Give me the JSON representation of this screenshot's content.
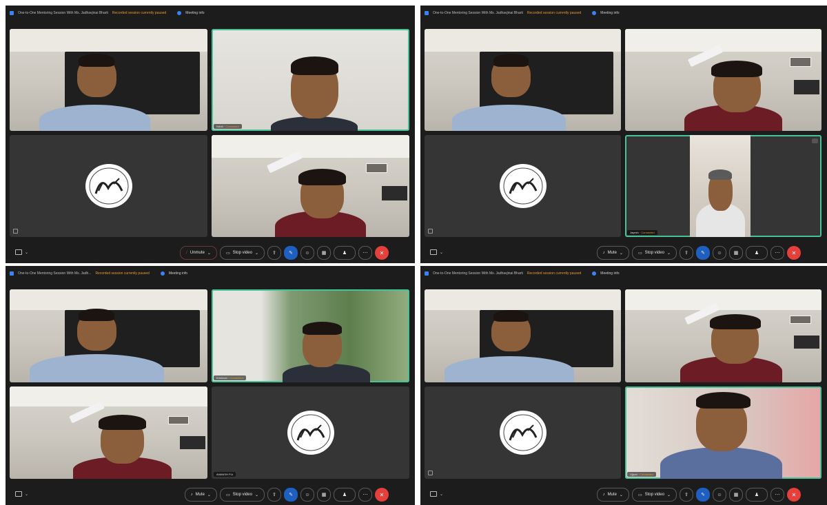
{
  "window": {
    "title": "One-to-One Mentoring Session With Ms. Jadhavjinai Bharti",
    "title_short": "One-to-One Mentoring Session With Ms. Jadh...",
    "recording_status": "Recorded session currently paused",
    "meeting_info": "Meeting info"
  },
  "toolbar": {
    "layout_label": "Layout",
    "unmute_label": "Unmute",
    "mute_label": "Mute",
    "stop_video_label": "Stop video",
    "mic_icon": "microphone-icon",
    "camera_icon": "camera-icon",
    "leave_icon": "phone-hangup-icon"
  },
  "participants": {
    "quad0_tile1": "Nikhil",
    "quad0_tile1_hl": "Connected",
    "quad1_pip": "Jayesh",
    "quad1_pip_hl": "Connected",
    "quad2_tile1": "Krishnan",
    "quad2_tile1_hl": "Connected",
    "quad2_tile3": "AVANISH P.A",
    "quad3_tile3": "Ujjwal",
    "quad3_tile3_hl": "Connected"
  },
  "colors": {
    "background": "#1c1c1c",
    "active_speaker_border": "#47c39a",
    "recording_status": "#e89a2e",
    "accent_blue": "#1f5fbf",
    "leave_red": "#e5403c"
  }
}
